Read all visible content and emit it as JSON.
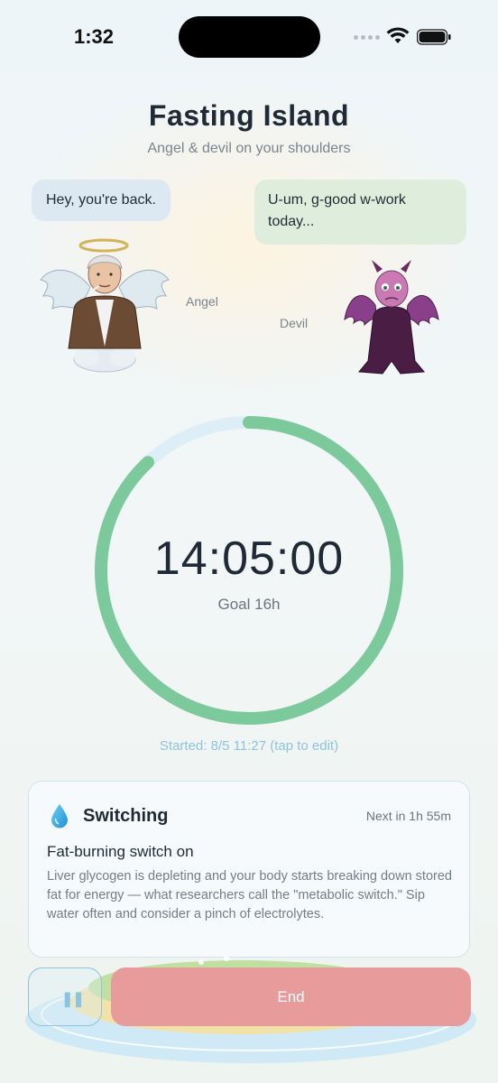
{
  "status_bar": {
    "time": "1:32"
  },
  "header": {
    "title": "Fasting Island",
    "subtitle": "Angel & devil on your shoulders"
  },
  "characters": {
    "angel": {
      "speech": "Hey, you're back.",
      "label": "Angel"
    },
    "devil": {
      "speech": "U-um, g-good w-work today...",
      "label": "Devil"
    }
  },
  "timer": {
    "elapsed": "14:05:00",
    "goal_label": "Goal 16h",
    "progress_fraction": 0.88,
    "started_label": "Started: 8/5 11:27 (tap to edit)"
  },
  "phase_card": {
    "icon": "water-drop-icon",
    "phase_name": "Switching",
    "next_label": "Next in 1h 55m",
    "headline": "Fat-burning switch on",
    "description": "Liver glycogen is depleting and your body starts breaking down stored fat for energy — what researchers call the \"metabolic switch.\" Sip water often and consider a pinch of electrolytes."
  },
  "actions": {
    "pause_icon": "pause-icon",
    "end_label": "End"
  },
  "colors": {
    "progress": "#7cc99b",
    "track": "#deeef7",
    "end_button": "#e89b9b",
    "accent_blue": "#8cc3df"
  }
}
